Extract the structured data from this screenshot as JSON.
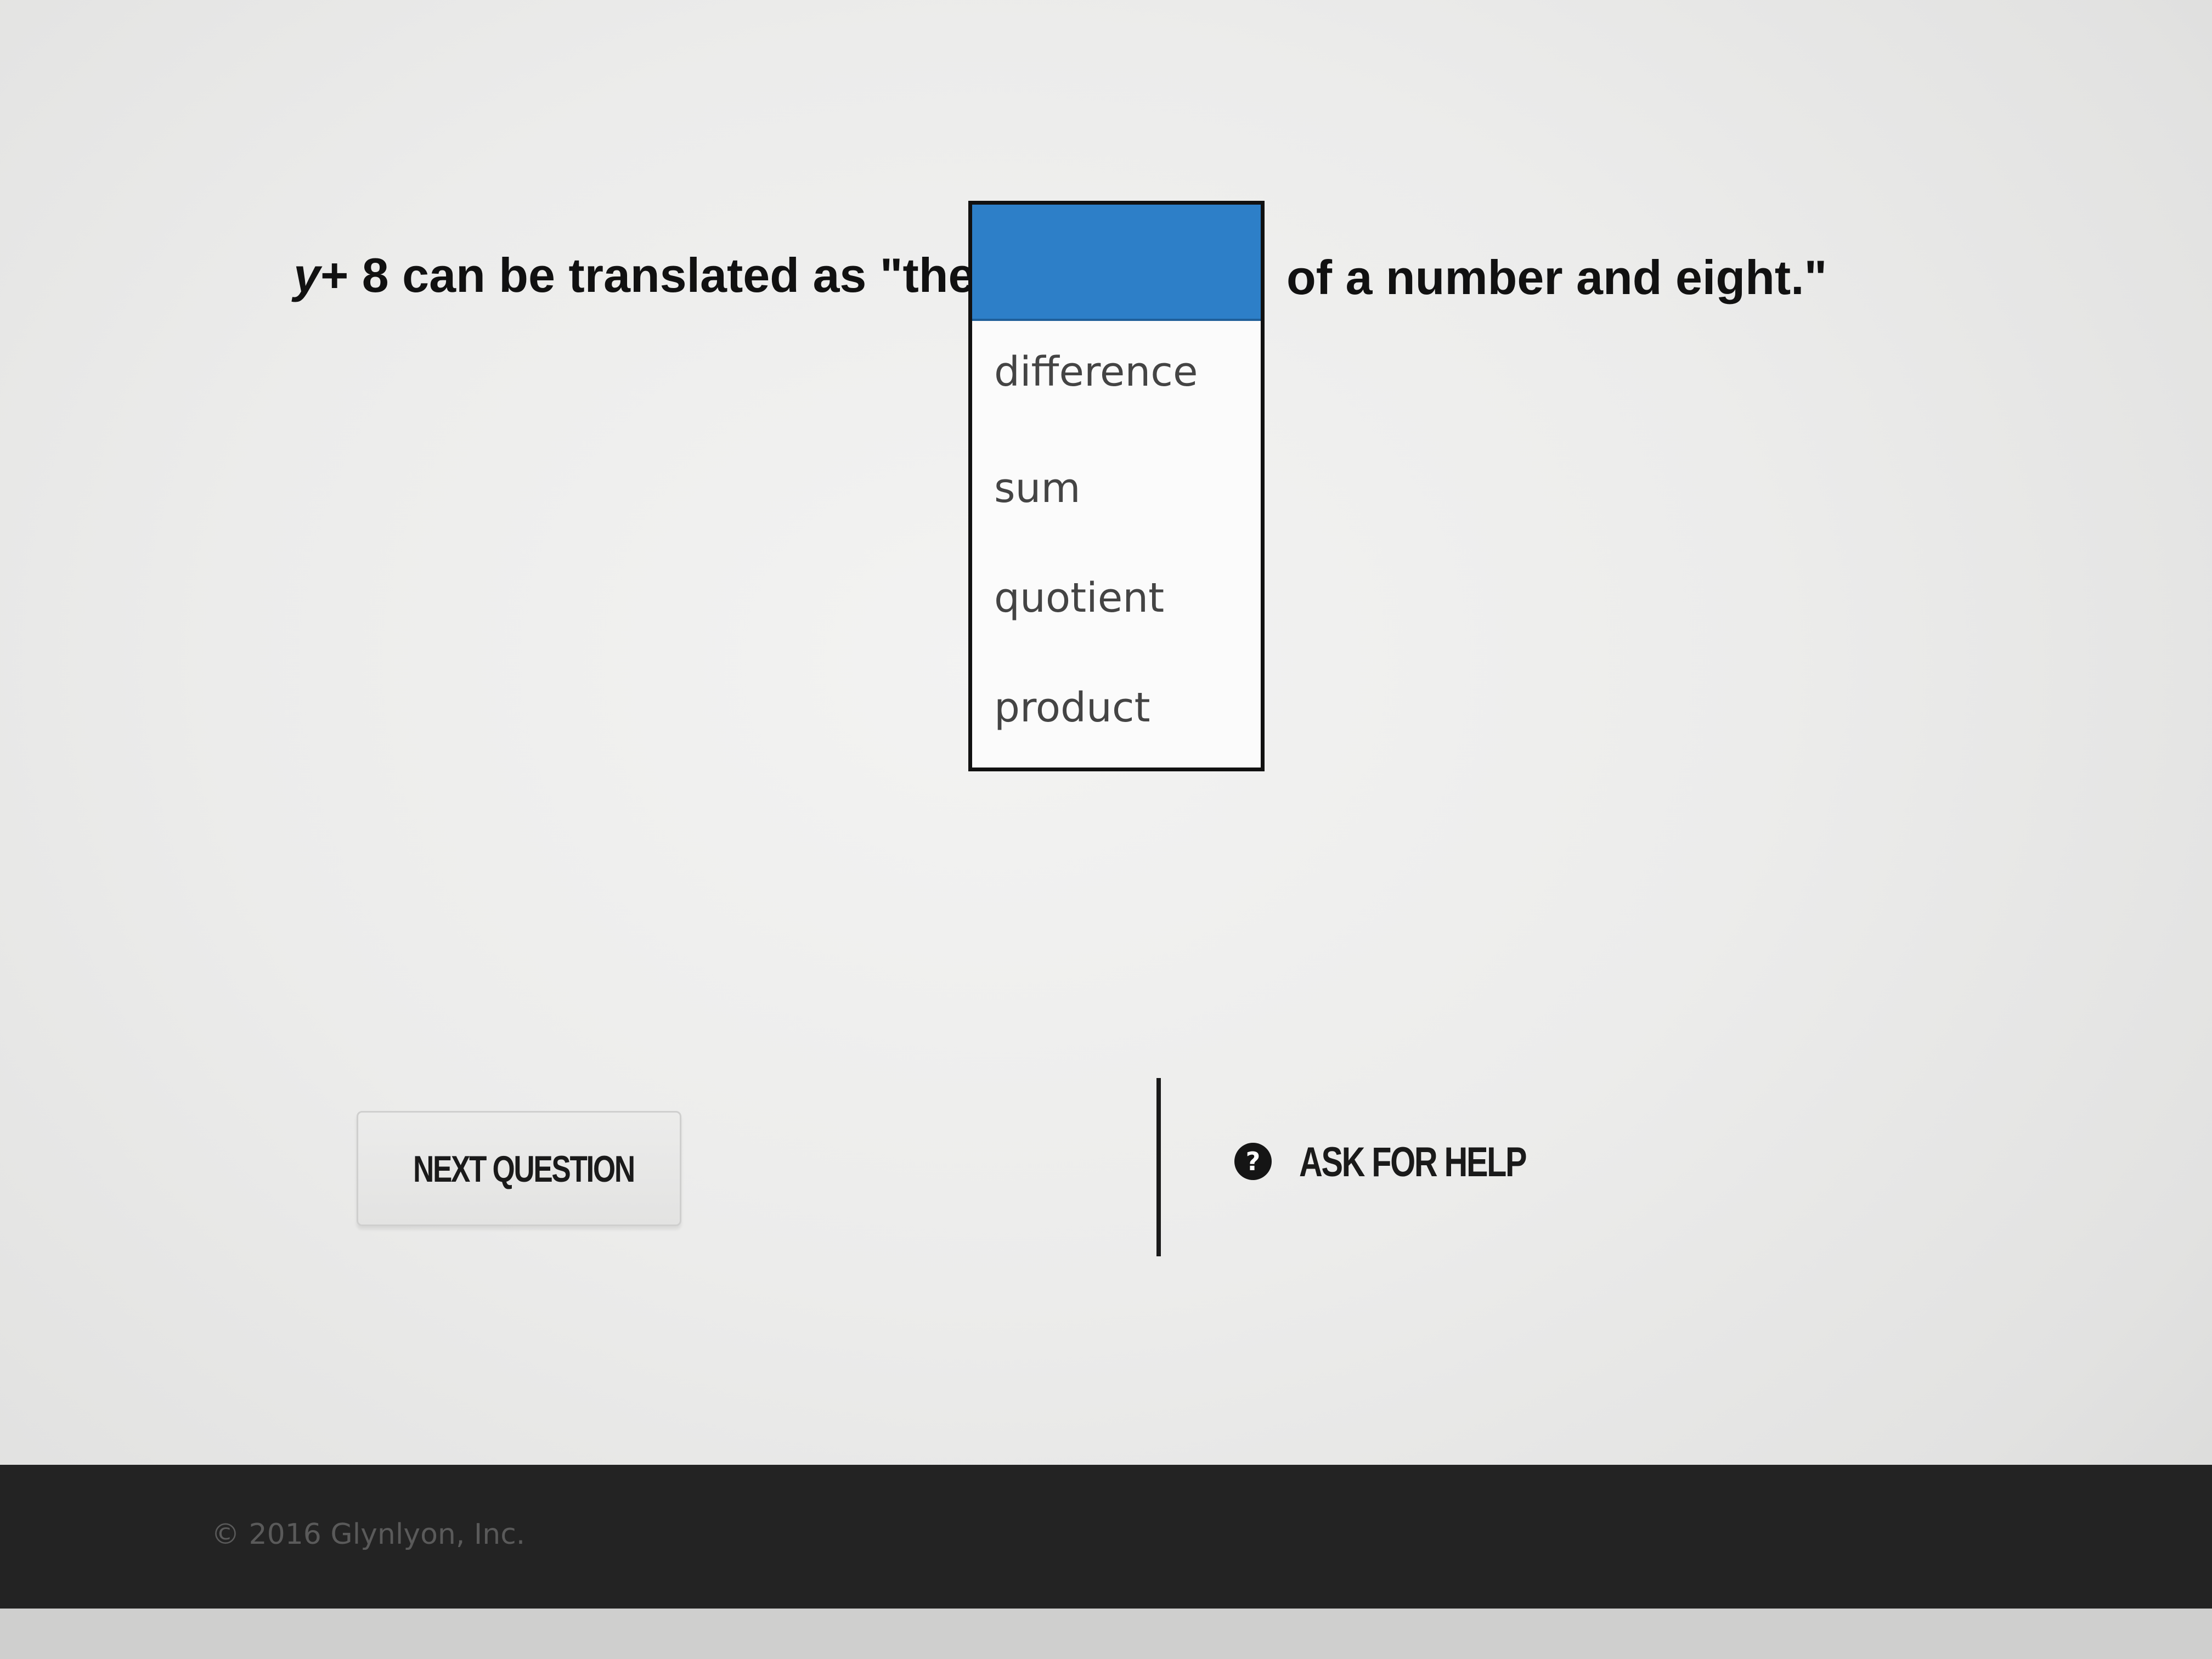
{
  "question": {
    "variable": "y",
    "expression_rest": "+ 8 can be translated as \"the",
    "text_after": "of a number and eight.\""
  },
  "dropdown": {
    "selected": "",
    "options": [
      "difference",
      "sum",
      "quotient",
      "product"
    ]
  },
  "buttons": {
    "next_question": "NEXT QUESTION",
    "ask_for_help": "ASK FOR HELP",
    "help_icon_glyph": "?"
  },
  "footer": {
    "copyright": "© 2016 Glynlyon, Inc."
  },
  "colors": {
    "selected_highlight": "#2d7fc8",
    "footer_background": "#232323"
  },
  "icons": {
    "help": "question-circle-icon"
  }
}
